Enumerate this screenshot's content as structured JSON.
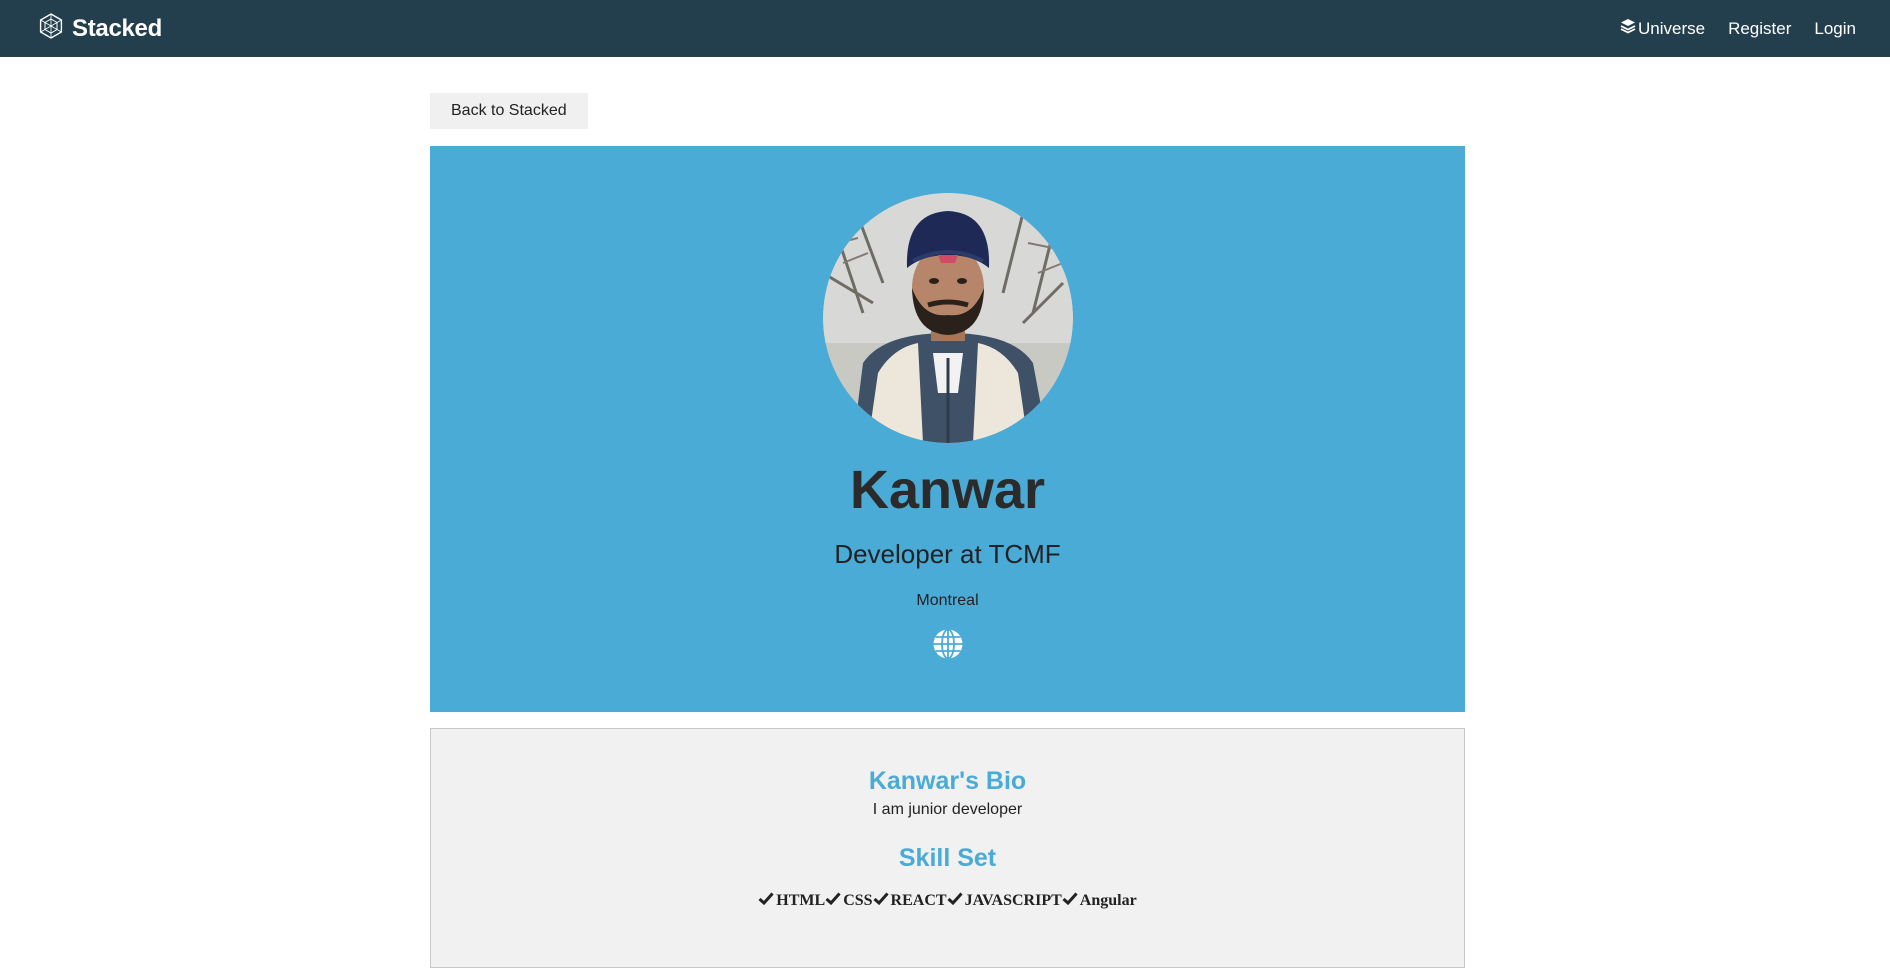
{
  "navbar": {
    "brand": "Stacked",
    "links": [
      {
        "label": "Universe",
        "icon": "layers-icon"
      },
      {
        "label": "Register"
      },
      {
        "label": "Login"
      }
    ]
  },
  "back_button": "Back to Stacked",
  "profile": {
    "name": "Kanwar",
    "title": "Developer at TCMF",
    "location": "Montreal",
    "website_icon": "globe-icon",
    "avatar_alt": "Kanwar"
  },
  "about": {
    "bio_heading": "Kanwar's Bio",
    "bio_text": "I am junior developer",
    "skills_heading": "Skill Set",
    "skills": [
      "HTML",
      "CSS",
      "REACT",
      "JAVASCRIPT",
      "Angular"
    ]
  },
  "colors": {
    "navbar_bg": "#233f4d",
    "profile_bg": "#4aabd7",
    "heading_accent": "#4aabd7",
    "about_bg": "#f1f1f1"
  }
}
